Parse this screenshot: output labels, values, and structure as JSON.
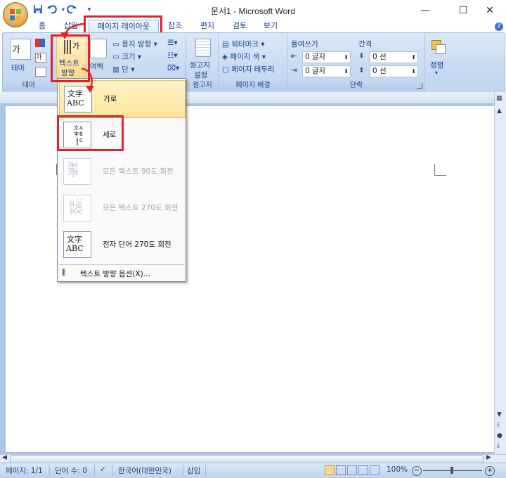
{
  "window": {
    "title": "문서1 - Microsoft Word",
    "controls": {
      "minimize": "—",
      "maximize": "☐",
      "close": "✕"
    }
  },
  "quick_access": {
    "save_icon": "save-icon",
    "undo_icon": "undo-icon",
    "redo_icon": "redo-icon",
    "customize": "▾"
  },
  "tabs": [
    {
      "label": "홈",
      "active": false
    },
    {
      "label": "삽입",
      "active": false
    },
    {
      "label": "페이지 레이아웃",
      "active": true
    },
    {
      "label": "참조",
      "active": false
    },
    {
      "label": "편지",
      "active": false
    },
    {
      "label": "검토",
      "active": false
    },
    {
      "label": "보기",
      "active": false
    }
  ],
  "ribbon": {
    "theme_group": {
      "label": "테마",
      "theme_button": "테마",
      "colors_button": "가"
    },
    "page_setup": {
      "text_direction": "텍스트",
      "text_direction_line2": "방향",
      "margins": "여백",
      "orientation": "용지 방향",
      "size": "크기",
      "columns": "단"
    },
    "manuscript": {
      "label": "원고지",
      "button_line1": "원고지",
      "button_line2": "설정"
    },
    "page_background": {
      "label": "페이지 배경",
      "watermark": "워터마크",
      "page_color": "페이지 색",
      "page_borders": "페이지 테두리"
    },
    "paragraph": {
      "label": "단락",
      "indent_title": "들여쓰기",
      "spacing_title": "간격",
      "indent_left": "0 글자",
      "indent_right": "0 글자",
      "spacing_before": "0 선",
      "spacing_after": "0 선"
    },
    "arrange": {
      "label": "정렬"
    }
  },
  "text_direction_menu": {
    "items": [
      {
        "label": "가로",
        "icon_top": "文字",
        "icon_bottom": "ABC",
        "enabled": true,
        "hover": true
      },
      {
        "label": "세로",
        "enabled": true,
        "selected": true
      },
      {
        "label": "모든 텍스트 90도 회전",
        "icon_top": "文字",
        "icon_bottom": "ABC",
        "enabled": false
      },
      {
        "label": "모든 텍스트 270도 회전",
        "icon_top": "文字",
        "icon_bottom": "ABC",
        "enabled": false
      },
      {
        "label": "전자 단어 270도 회전",
        "icon_top": "文字",
        "icon_bottom": "ABC",
        "enabled": true
      }
    ],
    "options_label": "텍스트 방향 옵션(X)..."
  },
  "statusbar": {
    "page": "페이지: 1/1",
    "words": "단어 수: 0",
    "language": "한국어(대한민국)",
    "mode": "삽입",
    "zoom": "100%"
  },
  "colors": {
    "accent_red": "#e0232b",
    "ribbon_blue": "#c6d9f1",
    "highlight": "#fbd98a"
  }
}
